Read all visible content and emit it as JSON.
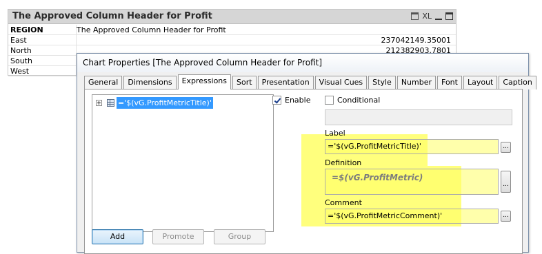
{
  "table": {
    "title": "The Approved Column Header for Profit",
    "caption_icons": {
      "print": "print-icon",
      "xl": "XL",
      "minimize": "minimize-icon",
      "maximize": "maximize-icon"
    },
    "header": [
      "REGION",
      "The Approved Column Header for Profit"
    ],
    "rows": [
      {
        "region": "East",
        "value": "237042149.35001"
      },
      {
        "region": "North",
        "value": "212382903.7801"
      },
      {
        "region": "South",
        "value": ""
      },
      {
        "region": "West",
        "value": ""
      }
    ]
  },
  "dialog": {
    "title": "Chart Properties [The Approved Column Header for Profit]",
    "tabs": [
      "General",
      "Dimensions",
      "Expressions",
      "Sort",
      "Presentation",
      "Visual Cues",
      "Style",
      "Number",
      "Font",
      "Layout",
      "Caption"
    ],
    "active_tab": "Expressions",
    "expression_tree": {
      "items": [
        {
          "label": "='$(vG.ProfitMetricTitle)'"
        }
      ]
    },
    "buttons": {
      "add": "Add",
      "promote": "Promote",
      "group": "Group",
      "ellipsis": "..."
    },
    "enable": {
      "label": "Enable",
      "checked": true
    },
    "conditional": {
      "label": "Conditional",
      "checked": false
    },
    "label_field": {
      "caption": "Label",
      "value": "='$(vG.ProfitMetricTitle)'"
    },
    "definition_field": {
      "caption": "Definition",
      "value": "=$(vG.ProfitMetric)"
    },
    "comment_field": {
      "caption": "Comment",
      "value": "='$(vG.ProfitMetricComment)'"
    },
    "highlight_color": "#ffff66",
    "selection_color": "#3399ff"
  }
}
